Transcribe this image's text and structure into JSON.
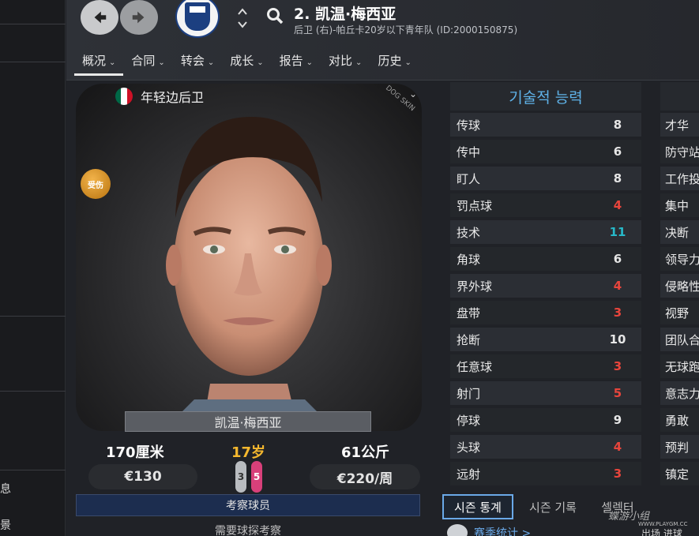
{
  "sidebar": {
    "items": [
      {
        "label": "息"
      },
      {
        "label": "景"
      }
    ]
  },
  "header": {
    "player_title": "2. 凯温·梅西亚",
    "player_subtitle": "后卫 (右)-帕丘卡20岁以下青年队 (ID:2000150875)",
    "tabs": [
      {
        "label": "概况"
      },
      {
        "label": "合同"
      },
      {
        "label": "转会"
      },
      {
        "label": "成长"
      },
      {
        "label": "报告"
      },
      {
        "label": "对比"
      },
      {
        "label": "历史"
      }
    ]
  },
  "profile": {
    "position_label": "年轻边后卫",
    "nationality_flag_colors": [
      "#006847",
      "#ffffff",
      "#ce1126"
    ],
    "portrait_watermark": "DOG SKIN",
    "injury_badge": "受伤",
    "name": "凯温·梅西亚",
    "height": "170厘米",
    "age": "17岁",
    "weight": "61公斤",
    "value": "€130",
    "left_foot": "3",
    "right_foot": "5",
    "wage": "€220/周",
    "scout_button": "考察球员",
    "scout_note": "需要球探考察"
  },
  "attributes": {
    "title": "기술적 능력",
    "technical": [
      {
        "label": "传球",
        "value": "8",
        "color": "#e6e6e6"
      },
      {
        "label": "传中",
        "value": "6",
        "color": "#e6e6e6"
      },
      {
        "label": "盯人",
        "value": "8",
        "color": "#e6e6e6"
      },
      {
        "label": "罚点球",
        "value": "4",
        "color": "#e8453c"
      },
      {
        "label": "技术",
        "value": "11",
        "color": "#27b9c9"
      },
      {
        "label": "角球",
        "value": "6",
        "color": "#e6e6e6"
      },
      {
        "label": "界外球",
        "value": "4",
        "color": "#e8453c"
      },
      {
        "label": "盘带",
        "value": "3",
        "color": "#e8453c"
      },
      {
        "label": "抢断",
        "value": "10",
        "color": "#e6e6e6"
      },
      {
        "label": "任意球",
        "value": "3",
        "color": "#e8453c"
      },
      {
        "label": "射门",
        "value": "5",
        "color": "#e8453c"
      },
      {
        "label": "停球",
        "value": "9",
        "color": "#e6e6e6"
      },
      {
        "label": "头球",
        "value": "4",
        "color": "#e8453c"
      },
      {
        "label": "远射",
        "value": "3",
        "color": "#e8453c"
      }
    ],
    "mental": [
      {
        "label": "才华"
      },
      {
        "label": "防守站"
      },
      {
        "label": "工作投"
      },
      {
        "label": "集中"
      },
      {
        "label": "决断"
      },
      {
        "label": "领导力"
      },
      {
        "label": "侵略性"
      },
      {
        "label": "视野"
      },
      {
        "label": "团队合"
      },
      {
        "label": "无球跑"
      },
      {
        "label": "意志力"
      },
      {
        "label": "勇敢"
      },
      {
        "label": "预判"
      },
      {
        "label": "镇定"
      }
    ]
  },
  "bottom_tabs": {
    "items": [
      {
        "label": "시즌 통계"
      },
      {
        "label": "시즌 기록"
      },
      {
        "label": "셀렉터"
      }
    ],
    "season_stats_link": "赛季统计 >",
    "col_labels": "出场    进球"
  },
  "watermark": {
    "text": "蝶游小组",
    "url": "WWW.PLAYGM.CC"
  }
}
